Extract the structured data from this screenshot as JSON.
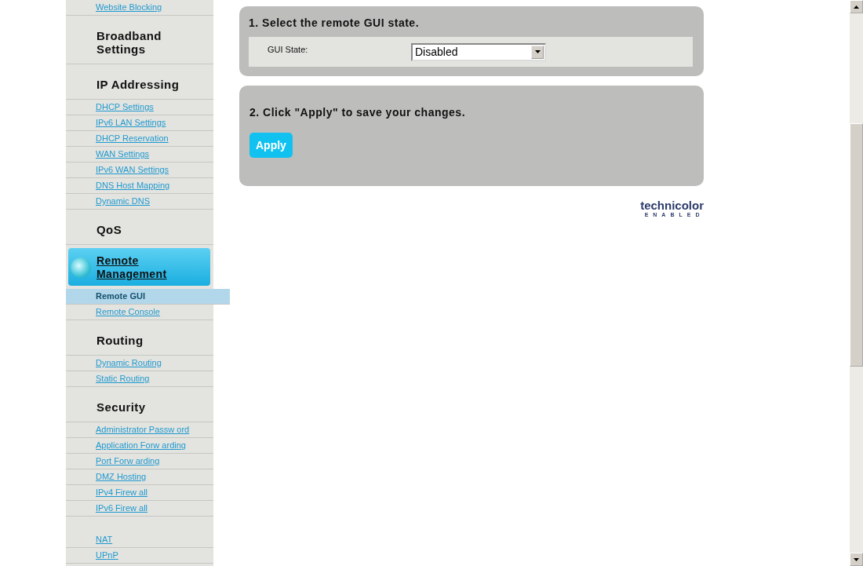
{
  "sidebar": {
    "groups": [
      {
        "links": [
          {
            "label": "Website Blocking",
            "selected": false
          }
        ]
      },
      {
        "title": "Broadband Settings",
        "selected": false
      },
      {
        "title": "IP Addressing",
        "selected": false,
        "links": [
          {
            "label": "DHCP Settings",
            "selected": false
          },
          {
            "label": "IPv6 LAN Settings",
            "selected": false
          },
          {
            "label": "DHCP Reservation",
            "selected": false
          },
          {
            "label": "WAN Settings",
            "selected": false
          },
          {
            "label": "IPv6 WAN Settings",
            "selected": false
          },
          {
            "label": "DNS Host Mapping",
            "selected": false
          },
          {
            "label": "Dynamic DNS",
            "selected": false
          }
        ]
      },
      {
        "title": "QoS",
        "selected": false
      },
      {
        "title": "Remote Management",
        "selected": true,
        "links": [
          {
            "label": "Remote GUI",
            "selected": true
          },
          {
            "label": "Remote Console",
            "selected": false
          }
        ]
      },
      {
        "title": "Routing",
        "selected": false,
        "links": [
          {
            "label": "Dynamic Routing",
            "selected": false
          },
          {
            "label": "Static Routing",
            "selected": false
          }
        ]
      },
      {
        "title": "Security",
        "selected": false,
        "links": [
          {
            "label": "Administrator Passw ord",
            "selected": false
          },
          {
            "label": "Application Forw arding",
            "selected": false
          },
          {
            "label": "Port Forw arding",
            "selected": false
          },
          {
            "label": "DMZ Hosting",
            "selected": false
          },
          {
            "label": "IPv4 Firew all",
            "selected": false
          },
          {
            "label": "IPv6 Firew all",
            "selected": false
          }
        ]
      },
      {
        "links": [
          {
            "label": "NAT",
            "selected": false
          },
          {
            "label": "UPnP",
            "selected": false
          }
        ]
      }
    ]
  },
  "steps": [
    {
      "kind": "field",
      "title": "1. Select the remote GUI state.",
      "field": {
        "label": "GUI State:",
        "value": "Disabled"
      }
    },
    {
      "kind": "button",
      "title": "2. Click \"Apply\" to save your changes.",
      "button": "Apply"
    }
  ],
  "logo": {
    "name": "technicolor",
    "tagline": "ENABLED"
  }
}
